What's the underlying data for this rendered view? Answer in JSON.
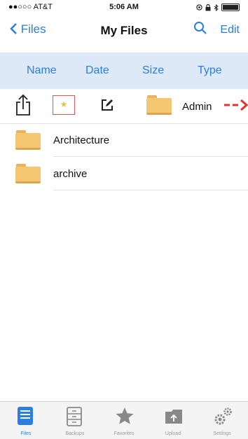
{
  "status_bar": {
    "carrier": "●●○○○ AT&T",
    "time": "5:06 AM"
  },
  "nav": {
    "back_label": "Files",
    "title": "My Files",
    "edit_label": "Edit"
  },
  "sort": {
    "name": "Name",
    "date": "Date",
    "size": "Size",
    "type": "Type"
  },
  "swiped_item": {
    "name": "Admin"
  },
  "files": [
    {
      "name": "Architecture"
    },
    {
      "name": "archive"
    }
  ],
  "tabs": [
    {
      "label": "Files"
    },
    {
      "label": "Backups"
    },
    {
      "label": "Favorites"
    },
    {
      "label": "Upload"
    },
    {
      "label": "Settings"
    }
  ],
  "colors": {
    "accent": "#2a7de1",
    "sort_bar_bg": "#dde9f6",
    "folder": "#f4c873",
    "favorite_border": "#e05555",
    "star": "#e8c23a",
    "arrow": "#e53030"
  }
}
